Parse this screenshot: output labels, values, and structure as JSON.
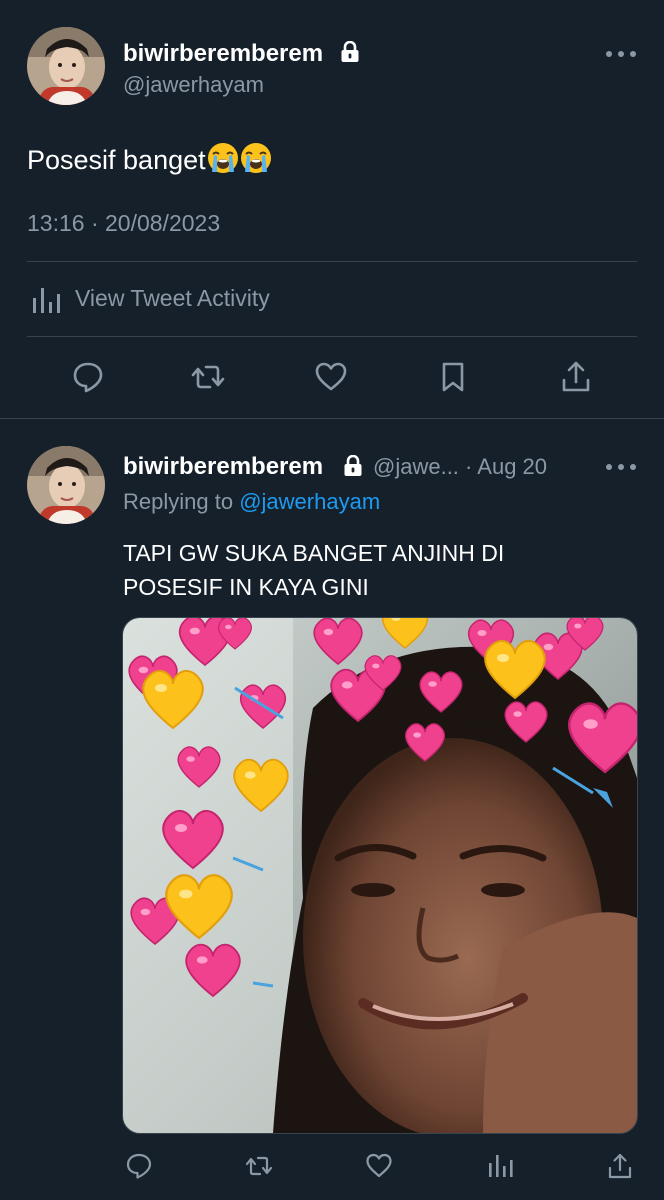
{
  "main_tweet": {
    "display_name": "biwirberemberem",
    "handle": "@jawerhayam",
    "text": "Posesif banget",
    "emoji": [
      "loudly-crying-face",
      "loudly-crying-face"
    ],
    "timestamp": "13:16 · 20/08/2023",
    "activity_label": "View Tweet Activity",
    "actions": [
      "reply-icon",
      "retweet-icon",
      "like-icon",
      "bookmark-icon",
      "share-icon"
    ]
  },
  "reply_tweet": {
    "display_name": "biwirberemberem",
    "handle_truncated": "@jawe...",
    "separator": "·",
    "date": "Aug 20",
    "replying_prefix": "Replying to",
    "replying_handle": "@jawerhayam",
    "text_line1": "TAPI GW SUKA BANGET ANJINH DI",
    "text_line2": "POSESIF IN KAYA GINI",
    "media_description_icon": "hearts-meme-photo",
    "actions": [
      "reply-icon",
      "retweet-icon",
      "like-icon",
      "analytics-icon",
      "share-icon"
    ]
  },
  "colors": {
    "background": "#15202b",
    "text_primary": "#ffffff",
    "text_secondary": "#8b98a5",
    "divider": "#38444d",
    "link": "#1d9bf0"
  }
}
